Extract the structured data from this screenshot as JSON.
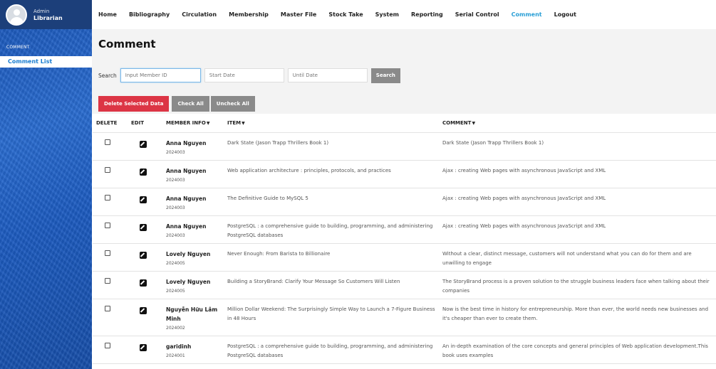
{
  "user": {
    "role": "Admin",
    "name": "Librarian"
  },
  "sidebar": {
    "section": "COMMENT",
    "items": [
      {
        "label": "Comment List"
      }
    ]
  },
  "nav": {
    "items": [
      {
        "label": "Home"
      },
      {
        "label": "Bibliography"
      },
      {
        "label": "Circulation"
      },
      {
        "label": "Membership"
      },
      {
        "label": "Master File"
      },
      {
        "label": "Stock Take"
      },
      {
        "label": "System"
      },
      {
        "label": "Reporting"
      },
      {
        "label": "Serial Control"
      },
      {
        "label": "Comment"
      },
      {
        "label": "Logout"
      }
    ],
    "active": "Comment",
    "active_color": "#2a9fd6"
  },
  "page": {
    "title": "Comment"
  },
  "search": {
    "label": "Search",
    "member_placeholder": "Input Member ID",
    "start_placeholder": "Start Date",
    "until_placeholder": "Until Date",
    "button": "Search"
  },
  "actions": {
    "delete_selected": "Delete Selected Data",
    "check_all": "Check All",
    "uncheck_all": "Uncheck All",
    "danger_color": "#dc3545"
  },
  "table": {
    "headers": {
      "delete": "DELETE",
      "edit": "EDIT",
      "member": "MEMBER INFO",
      "item": "ITEM",
      "comment": "COMMENT"
    },
    "rows": [
      {
        "name": "Anna Nguyen",
        "id": "2024003",
        "item": "Dark State (Jason Trapp Thrillers Book 1)",
        "comment": " Dark State (Jason Trapp Thrillers Book 1)"
      },
      {
        "name": "Anna Nguyen",
        "id": "2024003",
        "item": "Web application architecture : principles, protocols, and practices",
        "comment": "Ajax : creating Web pages with asynchronous JavaScript and XML"
      },
      {
        "name": "Anna Nguyen",
        "id": "2024003",
        "item": "The Definitive Guide to MySQL 5",
        "comment": "Ajax : creating Web pages with asynchronous JavaScript and XML"
      },
      {
        "name": "Anna Nguyen",
        "id": "2024003",
        "item": "PostgreSQL : a comprehensive guide to building, programming, and administering PostgreSQL databases",
        "comment": "Ajax : creating Web pages with asynchronous JavaScript and XML"
      },
      {
        "name": "Lovely Nguyen",
        "id": "2024005",
        "item": "Never Enough: From Barista to Billionaire",
        "comment": "Without a clear, distinct message, customers will not understand what you can do for them and are unwilling to engage"
      },
      {
        "name": "Lovely Nguyen",
        "id": "2024005",
        "item": "Building a StoryBrand: Clarify Your Message So Customers Will Listen",
        "comment": "The StoryBrand process is a proven solution to the struggle business leaders face when talking about their companies"
      },
      {
        "name": "Nguyễn Hữu Lâm Minh",
        "id": "2024002",
        "item": "Million Dollar Weekend: The Surprisingly Simple Way to Launch a 7-Figure Business in 48 Hours",
        "comment": "Now is the best time in history for entrepreneurship. More than ever, the world needs new businesses and it's cheaper than ever to create them."
      },
      {
        "name": "garidinh",
        "id": "2024001",
        "item": "PostgreSQL : a comprehensive guide to building, programming, and administering PostgreSQL databases",
        "comment": "An in-depth examination of the core concepts and general principles of Web application development.This book uses examples"
      }
    ]
  }
}
